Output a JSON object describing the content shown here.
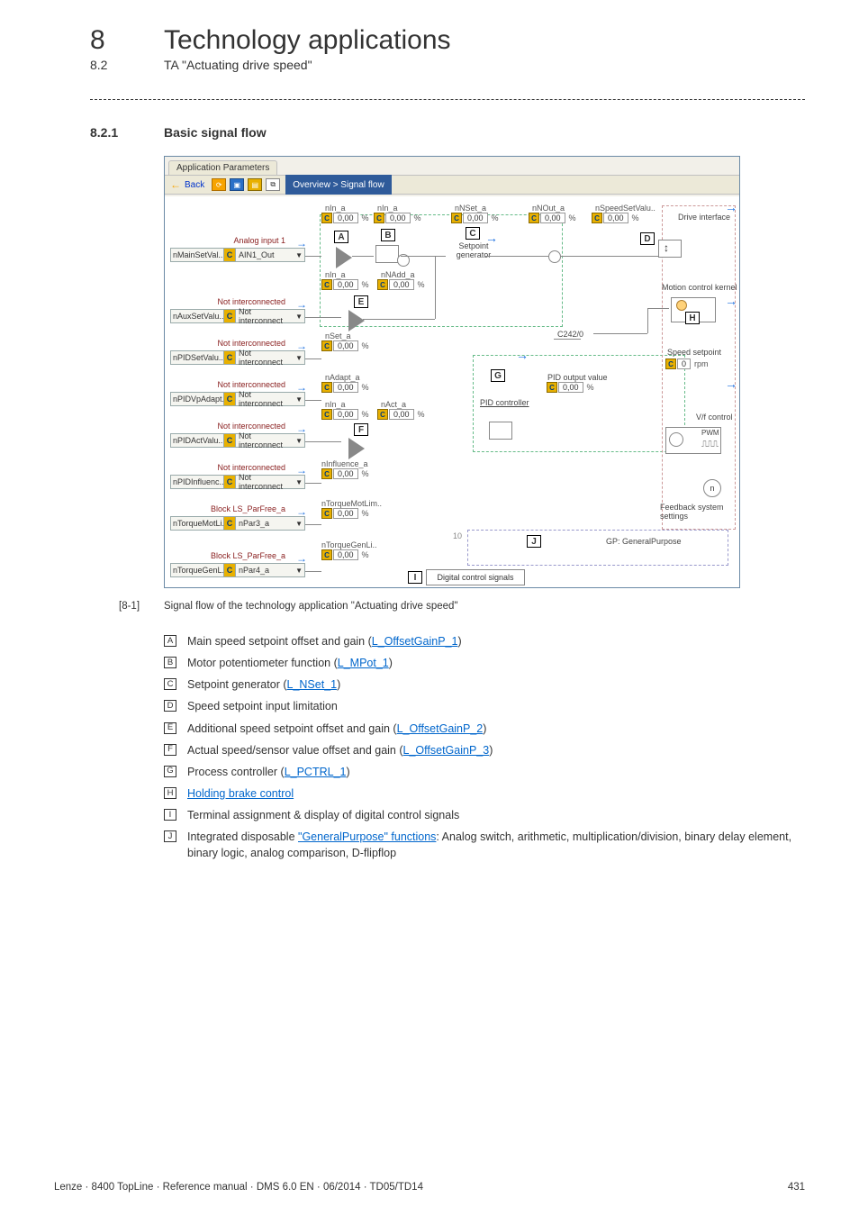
{
  "header": {
    "chapter_number": "8",
    "chapter_title": "Technology applications",
    "sub_number": "8.2",
    "sub_title": "TA \"Actuating drive speed\"",
    "section_number": "8.2.1",
    "section_title": "Basic signal flow"
  },
  "figure": {
    "tab": "Application Parameters",
    "back": "Back",
    "breadcrumb": "Overview > Signal flow",
    "labels": {
      "A": "A",
      "B": "B",
      "C": "C",
      "D": "D",
      "E": "E",
      "F": "F",
      "G": "G",
      "H": "H",
      "I": "I",
      "J": "J"
    },
    "varnames": {
      "nIn_a1": "nIn_a",
      "nIn_a2": "nIn_a",
      "nNSet_a": "nNSet_a",
      "nNOut_a": "nNOut_a",
      "nSpeedSetValu": "nSpeedSetValu..",
      "nIn_a3": "nIn_a",
      "nNAdd_a": "nNAdd_a",
      "nSet_a": "nSet_a",
      "nAdapt_a": "nAdapt_a",
      "nIn_a4": "nIn_a",
      "nAct_a": "nAct_a",
      "nInfluence_a": "nInfluence_a",
      "nTorqueMotLim": "nTorqueMotLim..",
      "nTorqueGenLi": "nTorqueGenLi.."
    },
    "values": {
      "zero": "0,00",
      "pct": "%",
      "rpm": "rpm",
      "speed0": "0",
      "ten": "10"
    },
    "ports": {
      "p1": {
        "title": "Analog input 1",
        "name": "nMainSetVal..",
        "sel": "AIN1_Out"
      },
      "p2": {
        "title": "Not interconnected",
        "name": "nAuxSetValu..",
        "sel": "Not interconnect"
      },
      "p3": {
        "title": "Not interconnected",
        "name": "nPIDSetValu..",
        "sel": "Not interconnect"
      },
      "p4": {
        "title": "Not interconnected",
        "name": "nPIDVpAdapt..",
        "sel": "Not interconnect"
      },
      "p5": {
        "title": "Not interconnected",
        "name": "nPIDActValu..",
        "sel": "Not interconnect"
      },
      "p6": {
        "title": "Not interconnected",
        "name": "nPIDInfluenc..",
        "sel": "Not interconnect"
      },
      "p7": {
        "title": "Block LS_ParFree_a",
        "name": "nTorqueMotLi..",
        "sel": "nPar3_a"
      },
      "p8": {
        "title": "Block LS_ParFree_a",
        "name": "nTorqueGenL..",
        "sel": "nPar4_a"
      }
    },
    "right": {
      "drive_interface": "Drive interface",
      "mck": "Motion control kernel",
      "speed_setpoint": "Speed setpoint",
      "vf": "V/f control",
      "pwm": "PWM",
      "feedback": "Feedback system settings",
      "gp": "GP: GeneralPurpose",
      "setpoint_gen": "Setpoint\ngenerator",
      "pid_ctrl": "PID controller",
      "pid_out": "PID output value",
      "c242": "C242/0",
      "digital": "Digital control signals"
    }
  },
  "caption": {
    "key": "[8-1]",
    "text": "Signal flow of the technology application \"Actuating drive speed\""
  },
  "legend": {
    "A": {
      "pre": "Main speed setpoint offset and gain (",
      "link": "L_OffsetGainP_1",
      "post": ")"
    },
    "B": {
      "pre": "Motor potentiometer function (",
      "link": "L_MPot_1",
      "post": ")"
    },
    "C": {
      "pre": "Setpoint generator (",
      "link": "L_NSet_1",
      "post": ")"
    },
    "D": {
      "text": "Speed setpoint input limitation"
    },
    "E": {
      "pre": "Additional speed setpoint offset and gain (",
      "link": "L_OffsetGainP_2",
      "post": ")"
    },
    "F": {
      "pre": "Actual speed/sensor value offset and gain (",
      "link": "L_OffsetGainP_3",
      "post": ")"
    },
    "G": {
      "pre": "Process controller (",
      "link": "L_PCTRL_1",
      "post": ")"
    },
    "H": {
      "link_only": "Holding brake control"
    },
    "I": {
      "text": "Terminal assignment & display of digital control signals"
    },
    "J": {
      "pre": "Integrated disposable ",
      "link": "\"GeneralPurpose\" functions",
      "post": ": Analog switch, arithmetic, multiplication/division, binary delay element, binary logic, analog comparison, D-flipflop"
    }
  },
  "footer": {
    "left": "Lenze · 8400 TopLine · Reference manual · DMS 6.0 EN · 06/2014 · TD05/TD14",
    "right": "431"
  }
}
